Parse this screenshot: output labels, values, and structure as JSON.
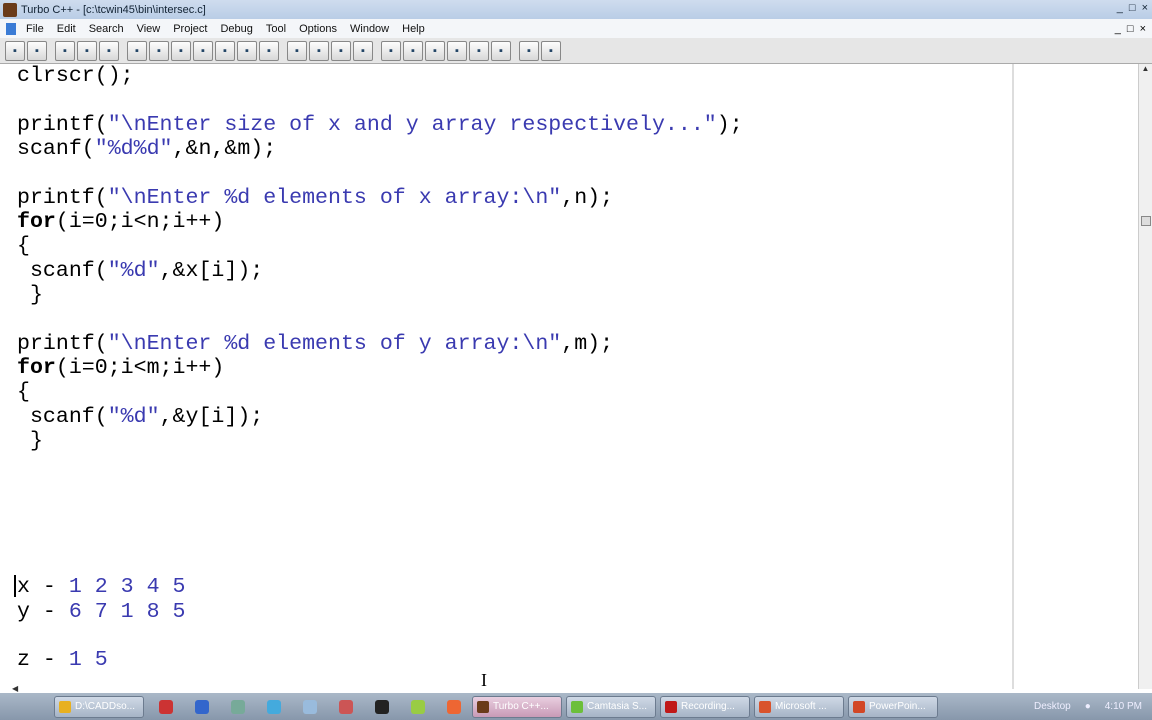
{
  "window": {
    "title": "Turbo C++ - [c:\\tcwin45\\bin\\intersec.c]",
    "controls": [
      "_",
      "□",
      "×"
    ],
    "mdi_controls": [
      "_",
      "□",
      "×"
    ]
  },
  "menu": [
    "File",
    "Edit",
    "Search",
    "View",
    "Project",
    "Debug",
    "Tool",
    "Options",
    "Window",
    "Help"
  ],
  "toolbar": [
    "open-project",
    "save-project",
    "open-file",
    "new-file",
    "save-file",
    "make",
    "compile",
    "build",
    "run",
    "step",
    "trace",
    "breakpoint",
    "undo",
    "cut",
    "copy",
    "paste",
    "find",
    "replace",
    "search-again",
    "goto-line",
    "inspect",
    "evaluate",
    "window-tile",
    "window-cascade"
  ],
  "code": [
    [
      {
        "t": "clrscr();",
        "c": "n"
      }
    ],
    [],
    [
      {
        "t": "printf(",
        "c": "n"
      },
      {
        "t": "\"\\nEnter size of x and y array respectively...\"",
        "c": "s"
      },
      {
        "t": ");",
        "c": "n"
      }
    ],
    [
      {
        "t": "scanf(",
        "c": "n"
      },
      {
        "t": "\"%d%d\"",
        "c": "s"
      },
      {
        "t": ",&n,&m);",
        "c": "n"
      }
    ],
    [],
    [
      {
        "t": "printf(",
        "c": "n"
      },
      {
        "t": "\"\\nEnter %d elements of x array:\\n\"",
        "c": "s"
      },
      {
        "t": ",n);",
        "c": "n"
      }
    ],
    [
      {
        "t": "for",
        "c": "k"
      },
      {
        "t": "(i=0;i<n;i++)",
        "c": "n"
      }
    ],
    [
      {
        "t": "{",
        "c": "n"
      }
    ],
    [
      {
        "t": " scanf(",
        "c": "n"
      },
      {
        "t": "\"%d\"",
        "c": "s"
      },
      {
        "t": ",&x[i]);",
        "c": "n"
      }
    ],
    [
      {
        "t": " }",
        "c": "n"
      }
    ],
    [],
    [
      {
        "t": "printf(",
        "c": "n"
      },
      {
        "t": "\"\\nEnter %d elements of y array:\\n\"",
        "c": "s"
      },
      {
        "t": ",m);",
        "c": "n"
      }
    ],
    [
      {
        "t": "for",
        "c": "k"
      },
      {
        "t": "(i=0;i<m;i++)",
        "c": "n"
      }
    ],
    [
      {
        "t": "{",
        "c": "n"
      }
    ],
    [
      {
        "t": " scanf(",
        "c": "n"
      },
      {
        "t": "\"%d\"",
        "c": "s"
      },
      {
        "t": ",&y[i]);",
        "c": "n"
      }
    ],
    [
      {
        "t": " }",
        "c": "n"
      }
    ],
    [],
    [],
    [],
    [],
    [],
    [
      {
        "t": "x - ",
        "c": "n"
      },
      {
        "t": "1 2 3 4 5",
        "c": "num"
      }
    ],
    [
      {
        "t": "y - ",
        "c": "n"
      },
      {
        "t": "6 7 1 8 5",
        "c": "num"
      }
    ],
    [],
    [
      {
        "t": "z - ",
        "c": "n"
      },
      {
        "t": "1 5",
        "c": "num"
      }
    ]
  ],
  "taskbar": {
    "tasks": [
      {
        "label": "D:\\CADDso...",
        "color": "#e8b020"
      },
      {
        "label": "Turbo C++...",
        "color": "#6a3b1a",
        "active": true
      },
      {
        "label": "Camtasia S...",
        "color": "#6cbf3a"
      },
      {
        "label": "Recording...",
        "color": "#c01818"
      },
      {
        "label": "Microsoft ...",
        "color": "#d9532c"
      },
      {
        "label": "PowerPoin...",
        "color": "#d24726"
      }
    ],
    "quicklaunch": [
      "acrobat-icon",
      "app-icon",
      "media-icon",
      "network-icon",
      "document-icon",
      "powerpoint-icon",
      "app2-icon",
      "folder-icon",
      "firefox-icon"
    ],
    "desktop_label": "Desktop",
    "clock": "4:10 PM"
  }
}
